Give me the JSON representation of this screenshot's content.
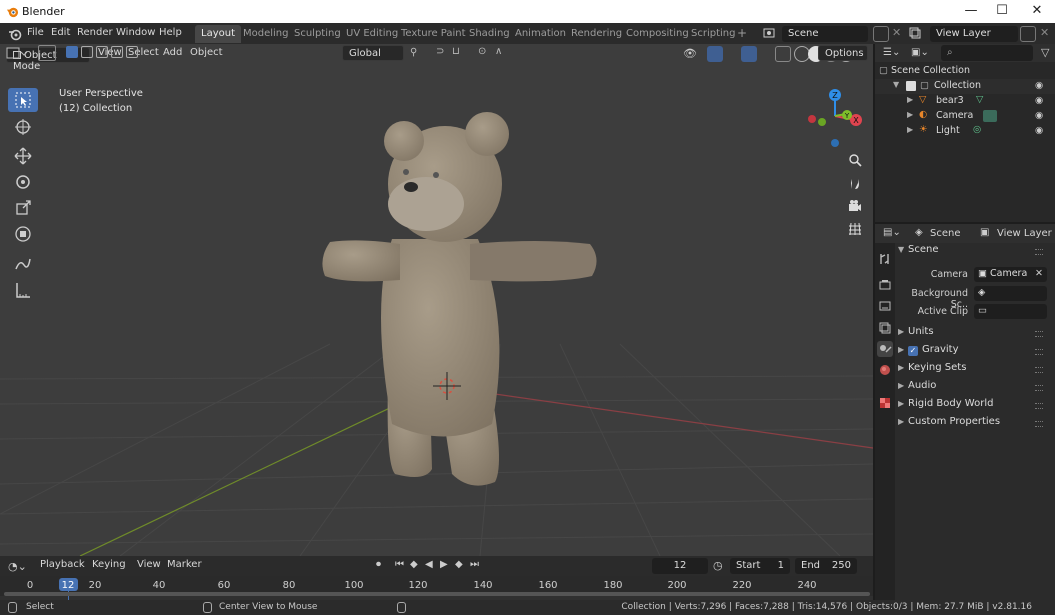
{
  "window": {
    "title": "Blender",
    "minimize": "—",
    "maximize": "☐",
    "close": "✕"
  },
  "menus": [
    "File",
    "Edit",
    "Render",
    "Window",
    "Help"
  ],
  "workspaces": [
    "Layout",
    "Modeling",
    "Sculpting",
    "UV Editing",
    "Texture Paint",
    "Shading",
    "Animation",
    "Rendering",
    "Compositing",
    "Scripting"
  ],
  "active_workspace": "Layout",
  "add_workspace": "+",
  "scene_field": "Scene",
  "view_layer_field": "View Layer",
  "viewport": {
    "mode": "Object Mode",
    "menu": [
      "View",
      "Select",
      "Add",
      "Object"
    ],
    "transform_orientation": "Global",
    "options_label": "Options",
    "perspective_label": "User Perspective",
    "collection_label": "(12) Collection",
    "gizmo": {
      "z": "Z",
      "y": "Y",
      "x": "X"
    }
  },
  "timeline": {
    "menu": [
      "Playback",
      "Keying",
      "View",
      "Marker"
    ],
    "current_frame": "12",
    "start_label": "Start",
    "start_value": "1",
    "end_label": "End",
    "end_value": "250",
    "ruler": [
      "0",
      "12",
      "20",
      "40",
      "60",
      "80",
      "100",
      "120",
      "140",
      "160",
      "180",
      "200",
      "220",
      "240"
    ]
  },
  "outliner": {
    "search_placeholder": "",
    "root": "Scene Collection",
    "collection": "Collection",
    "items": [
      "bear3",
      "Camera",
      "Light"
    ]
  },
  "properties": {
    "header_scene": "Scene",
    "header_view_layer": "View Layer",
    "section_title": "Scene",
    "camera_label": "Camera",
    "camera_value": "Camera",
    "background_label": "Background Sc..",
    "active_clip_label": "Active Clip",
    "subsections": [
      "Units",
      "Gravity",
      "Keying Sets",
      "Audio",
      "Rigid Body World",
      "Custom Properties"
    ]
  },
  "status": {
    "left_action": "Select",
    "middle_action": "Center View to Mouse",
    "stats": "Collection | Verts:7,296 | Faces:7,288 | Tris:14,576 | Objects:0/3 | Mem: 27.7 MiB | v2.81.16"
  },
  "colors": {
    "accent": "#4772b3",
    "viewport_bg": "#3d3d3d",
    "bear": "#8e8270",
    "axis_x": "#e0444f",
    "axis_y": "#7ebf2a",
    "axis_z": "#2f8ee8"
  },
  "icons": [
    "blender-logo-icon",
    "editor-type-icon",
    "select-box-icon",
    "cursor-icon",
    "move-icon",
    "rotate-icon",
    "scale-icon",
    "transform-icon",
    "annotate-icon",
    "measure-icon",
    "zoom-icon",
    "hand-icon",
    "camera-view-icon",
    "grid-icon",
    "eye-icon",
    "search-icon",
    "filter-icon",
    "mesh-icon",
    "camera-icon",
    "light-icon"
  ]
}
